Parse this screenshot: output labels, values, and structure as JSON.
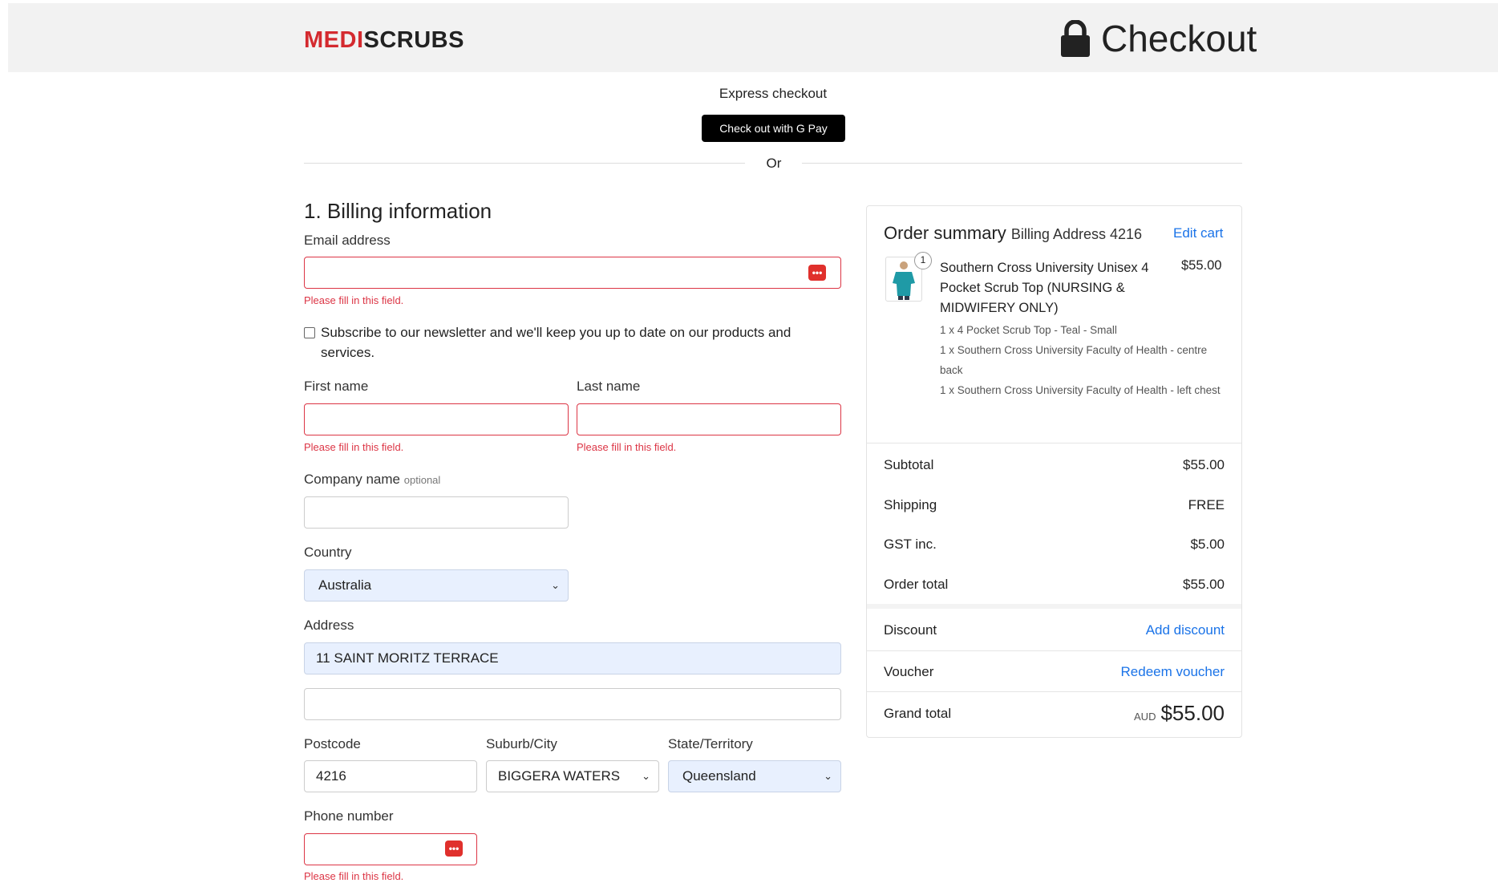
{
  "brand": {
    "logo_red": "MEDI",
    "logo_dark": "SCRUBS",
    "page_title": "Checkout"
  },
  "express": {
    "label": "Express checkout",
    "button": "Check out with G Pay",
    "or": "Or"
  },
  "billing": {
    "title": "1. Billing information",
    "email_label": "Email address",
    "email_value": "",
    "error": "Please fill in this field.",
    "newsletter": "Subscribe to our newsletter and we'll keep you up to date on our products and services.",
    "first_name_label": "First name",
    "last_name_label": "Last name",
    "company_label": "Company name",
    "company_optional": "optional",
    "country_label": "Country",
    "country_value": "Australia",
    "address_label": "Address",
    "address_line1": "11 SAINT MORITZ TERRACE",
    "address_line2": "",
    "postcode_label": "Postcode",
    "postcode_value": "4216",
    "suburb_label": "Suburb/City",
    "suburb_value": "BIGGERA WATERS",
    "state_label": "State/Territory",
    "state_value": "Queensland",
    "phone_label": "Phone number"
  },
  "summary": {
    "title": "Order summary",
    "subtitle": "Billing Address 4216",
    "edit_cart": "Edit cart",
    "item": {
      "qty_badge": "1",
      "name": "Southern Cross University Unisex 4 Pocket Scrub Top (NURSING & MIDWIFERY ONLY)",
      "price": "$55.00",
      "variants": [
        "1 x 4 Pocket Scrub Top - Teal - Small",
        "1 x Southern Cross University Faculty of Health - centre back",
        "1 x Southern Cross University Faculty of Health - left chest"
      ]
    },
    "subtotal_label": "Subtotal",
    "subtotal": "$55.00",
    "shipping_label": "Shipping",
    "shipping": "FREE",
    "gst_label": "GST inc.",
    "gst": "$5.00",
    "order_total_label": "Order total",
    "order_total": "$55.00",
    "discount_label": "Discount",
    "discount_link": "Add discount",
    "voucher_label": "Voucher",
    "voucher_link": "Redeem voucher",
    "grand_total_label": "Grand total",
    "currency": "AUD",
    "grand_total": "$55.00"
  },
  "colors": {
    "brand_red": "#d42a2f",
    "error": "#dc3545",
    "link": "#1a73e8",
    "autofill": "#e8f0fe"
  }
}
